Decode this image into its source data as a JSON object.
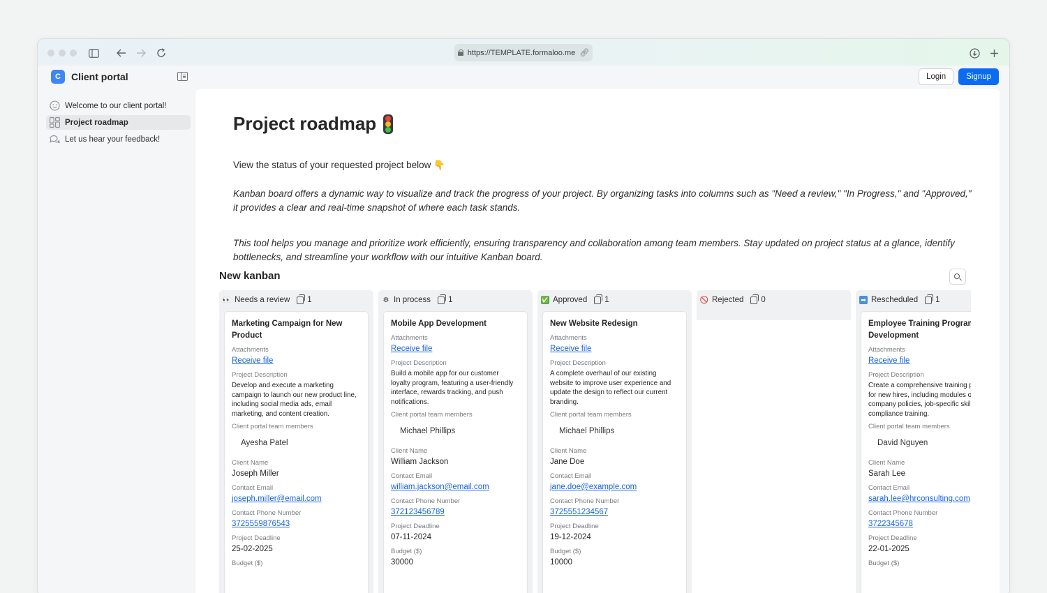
{
  "browser": {
    "url": "https://TEMPLATE.formaloo.me"
  },
  "app": {
    "brand_initial": "C",
    "brand_name": "Client portal",
    "nav": [
      {
        "label": "Welcome to our client portal!",
        "icon": "smiley-icon"
      },
      {
        "label": "Project roadmap",
        "icon": "dashboard-icon",
        "active": true
      },
      {
        "label": "Let us hear your feedback!",
        "icon": "chat-bubbles-icon"
      }
    ],
    "login_label": "Login",
    "signup_label": "Signup",
    "accent_color": "#0a6cf0"
  },
  "page": {
    "title": "Project roadmap",
    "intro": "View the status of your requested project below 👇",
    "para1": "Kanban board offers a dynamic way to visualize and track the progress of your project. By organizing tasks into columns such as \"Need a review,\" \"In Progress,\" and \"Approved,\" it provides a clear and real-time snapshot of where each task stands.",
    "para2": "This tool helps you manage and prioritize work efficiently, ensuring transparency and collaboration among team members. Stay updated on project status at a glance, identify bottlenecks, and streamline your workflow with our intuitive Kanban board."
  },
  "kanban": {
    "title": "New kanban",
    "labels": {
      "attachments": "Attachments",
      "description": "Project Description",
      "members": "Client portal team members",
      "client_name": "Client Name",
      "email": "Contact Email",
      "phone": "Contact Phone Number",
      "deadline": "Project Deadline",
      "budget": "Budget ($)"
    },
    "columns": [
      {
        "name": "Needs a review",
        "emoji": "👀",
        "count": "1",
        "card": {
          "title": "Marketing Campaign for New Product",
          "attachment": "Receive file",
          "description": "Develop and execute a marketing campaign to launch our new product line, including social media ads, email marketing, and content creation.",
          "member": "Ayesha Patel",
          "client_name": "Joseph Miller",
          "email": "joseph.miller@email.com",
          "phone": "3725559876543",
          "deadline": "25-02-2025",
          "budget": ""
        }
      },
      {
        "name": "In process",
        "emoji": "⚙",
        "count": "1",
        "card": {
          "title": "Mobile App Development",
          "attachment": "Receive file",
          "description": "Build a mobile app for our customer loyalty program, featuring a user-friendly interface, rewards tracking, and push notifications.",
          "member": "Michael Phillips",
          "client_name": "William Jackson",
          "email": "william.jackson@email.com",
          "phone": "372123456789",
          "deadline": "07-11-2024",
          "budget": "30000"
        }
      },
      {
        "name": "Approved",
        "emoji": "✅",
        "count": "1",
        "card": {
          "title": "New Website Redesign",
          "attachment": "Receive file",
          "description": "A complete overhaul of our existing website to improve user experience and update the design to reflect our current branding.",
          "member": "Michael Phillips",
          "client_name": "Jane Doe",
          "email": "jane.doe@example.com",
          "phone": "3725551234567",
          "deadline": "19-12-2024",
          "budget": "10000"
        }
      },
      {
        "name": "Rejected",
        "emoji": "🚫",
        "count": "0",
        "card": null
      },
      {
        "name": "Rescheduled",
        "emoji": "➡",
        "count": "1",
        "card": {
          "title": "Employee Training Program Development",
          "attachment": "Receive file",
          "description": "Create a comprehensive training program for new hires, including modules on company policies, job-specific skills, and compliance training.",
          "member": "David Nguyen",
          "client_name": "Sarah Lee",
          "email": "sarah.lee@hrconsulting.com",
          "phone": "3722345678",
          "deadline": "22-01-2025",
          "budget": ""
        }
      }
    ]
  }
}
